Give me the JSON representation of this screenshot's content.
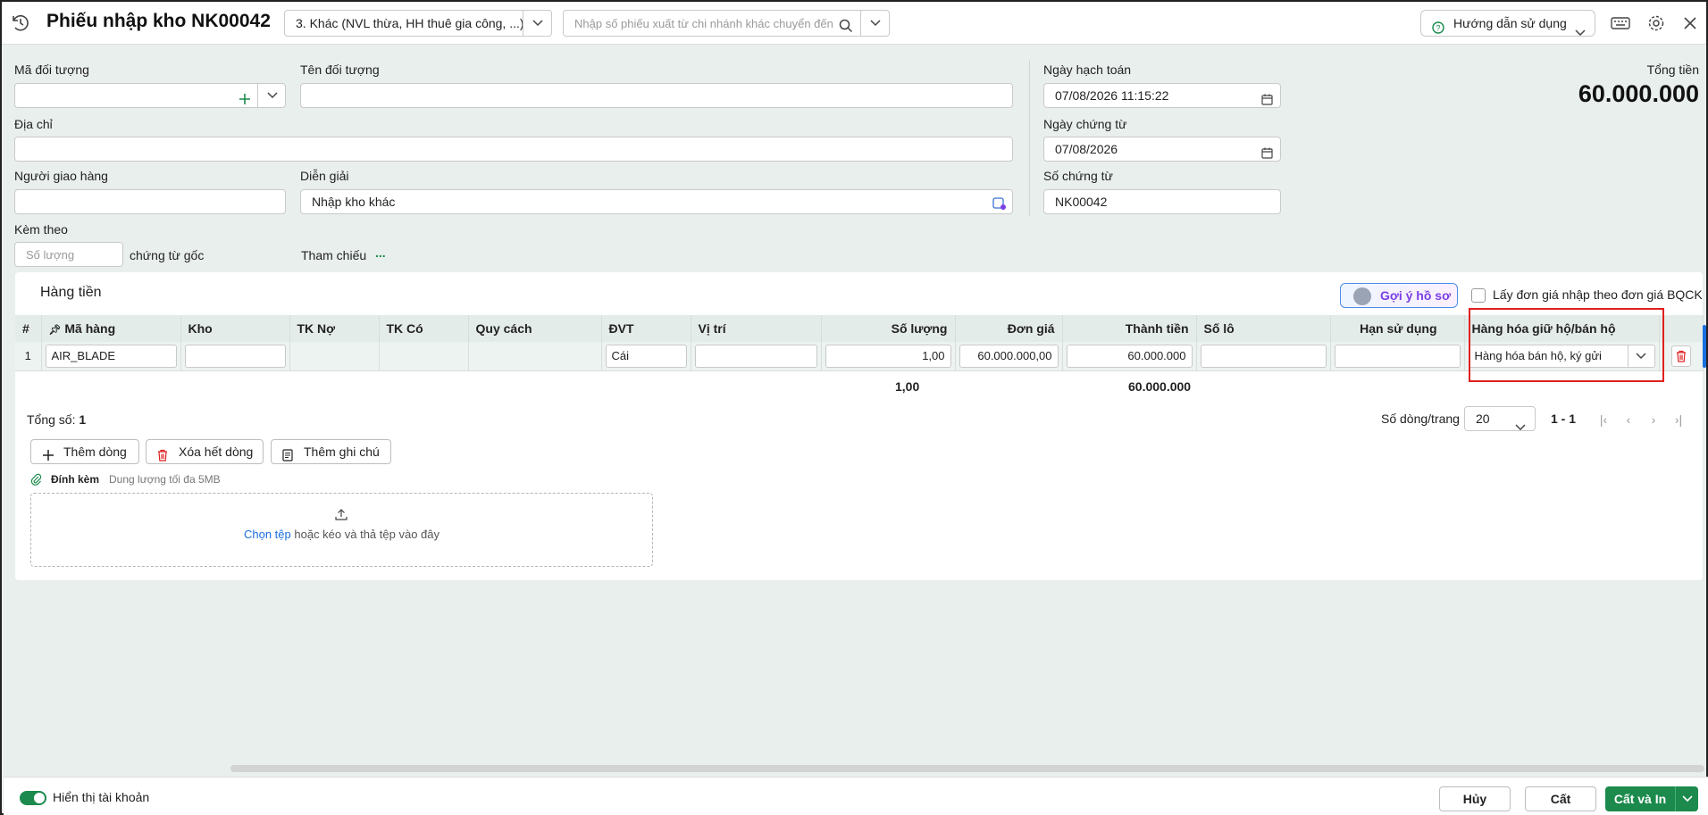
{
  "header": {
    "title": "Phiếu nhập kho NK00042",
    "type_select": "3. Khác (NVL thừa, HH thuê gia công, ...)",
    "search_placeholder": "Nhập số phiếu xuất từ chi nhánh khác chuyển đến",
    "help_label": "Hướng dẫn sử dụng"
  },
  "form": {
    "ma_doi_tuong_label": "Mã đối tượng",
    "ten_doi_tuong_label": "Tên đối tượng",
    "dia_chi_label": "Địa chỉ",
    "nguoi_giao_hang_label": "Người giao hàng",
    "dien_giai_label": "Diễn giải",
    "dien_giai_value": "Nhập kho khác",
    "kem_theo_label": "Kèm theo",
    "so_luong_placeholder": "Số lượng",
    "chung_tu_goc": "chứng từ gốc",
    "tham_chieu_label": "Tham chiếu",
    "tham_chieu_value": "...",
    "ngay_hach_toan_label": "Ngày hạch toán",
    "ngay_hach_toan_value": "07/08/2026 11:15:22",
    "ngay_chung_tu_label": "Ngày chứng từ",
    "ngay_chung_tu_value": "07/08/2026",
    "so_chung_tu_label": "Số chứng từ",
    "so_chung_tu_value": "NK00042",
    "tong_tien_label": "Tổng tiền",
    "tong_tien_value": "60.000.000"
  },
  "panel": {
    "title": "Hàng tiền",
    "goi_y_label": "Gợi ý hồ sơ",
    "lay_don_gia_label": "Lấy đơn giá nhập theo đơn giá BQCK",
    "columns": [
      "#",
      "Mã hàng",
      "Kho",
      "TK Nợ",
      "TK Có",
      "Quy cách",
      "ĐVT",
      "Vị trí",
      "Số lượng",
      "Đơn giá",
      "Thành tiền",
      "Số lô",
      "Hạn sử dụng",
      "Hàng hóa giữ hộ/bán hộ"
    ],
    "row": {
      "index": "1",
      "ma_hang": "AIR_BLADE",
      "dvt": "Cái",
      "so_luong": "1,00",
      "don_gia": "60.000.000,00",
      "thanh_tien": "60.000.000",
      "hang_hoa": "Hàng hóa bán hộ, ký gửi"
    },
    "sum_so_luong": "1,00",
    "sum_thanh_tien": "60.000.000",
    "tong_so_label": "Tổng số:",
    "tong_so_value": "1",
    "so_dong_label": "Số dòng/trang",
    "so_dong_value": "20",
    "range": "1 - 1",
    "them_dong": "Thêm dòng",
    "xoa_het_dong": "Xóa hết dòng",
    "them_ghi_chu": "Thêm ghi chú",
    "dinh_kem": "Đính kèm",
    "dung_luong": "Dung lượng tối đa 5MB",
    "chon_tep": "Chọn tệp",
    "keo_tha": "hoặc kéo và thả tệp vào đây"
  },
  "footer": {
    "hien_thi_tai_khoan": "Hiển thị tài khoản",
    "huy": "Hủy",
    "cat": "Cất",
    "cat_va_in": "Cất và In"
  },
  "colors": {
    "primary": "#1b8a4c",
    "highlight": "#e02020",
    "link": "#1a6fe0"
  }
}
